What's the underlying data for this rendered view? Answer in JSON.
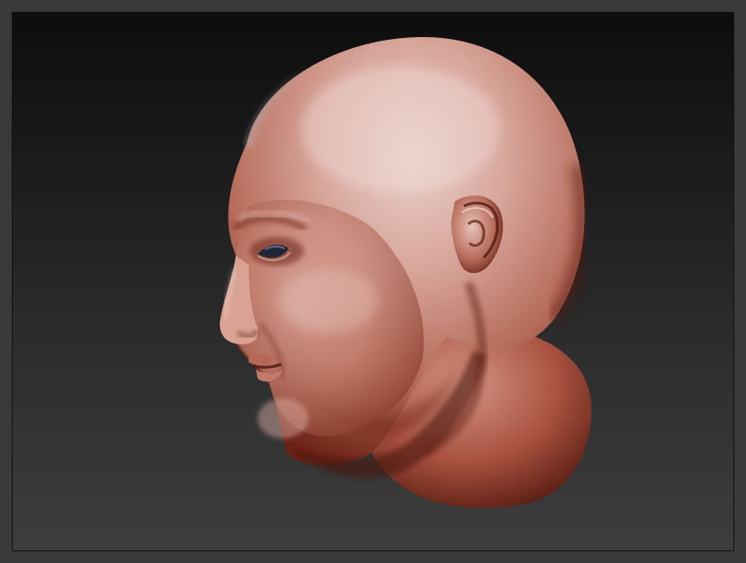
{
  "scene": {
    "subject": "sculpted-head-profile",
    "material_colors": {
      "highlight": "#e8c7c0",
      "mid": "#c98676",
      "shadow": "#7a2a1c",
      "deep_shadow": "#4a1409",
      "rim_light": "#b7c4d6"
    },
    "background_colors": {
      "top": "#0d0d0d",
      "bottom": "#3d3d3d",
      "frame": "#393939"
    }
  }
}
